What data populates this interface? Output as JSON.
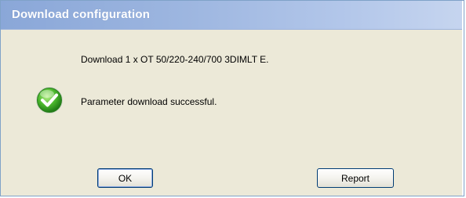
{
  "window": {
    "title": "Download configuration"
  },
  "message": {
    "download_line": "Download 1 x OT 50/220-240/700 3DIMLT E.",
    "status_line": "Parameter download successful.",
    "status_icon": "success-checkmark-icon",
    "status_color": "#3aa02a"
  },
  "buttons": {
    "ok_label": "OK",
    "report_label": "Report"
  },
  "colors": {
    "title_bar": "#9db6e0",
    "title_text": "#ffffff",
    "dialog_bg": "#ece9d8",
    "button_border": "#003c74"
  }
}
